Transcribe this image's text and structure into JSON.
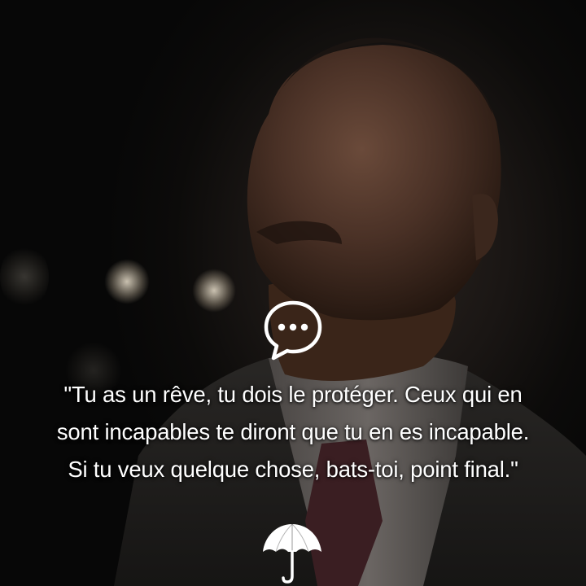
{
  "quote": {
    "lines": [
      "\"Tu as un rêve, tu dois le protéger. Ceux qui en",
      "sont incapables te diront que tu en es incapable.",
      "Si tu veux quelque chose, bats-toi, point final.\""
    ]
  },
  "icons": {
    "top": "speech-bubble-icon",
    "bottom": "umbrella-icon",
    "color": "#ffffff"
  }
}
